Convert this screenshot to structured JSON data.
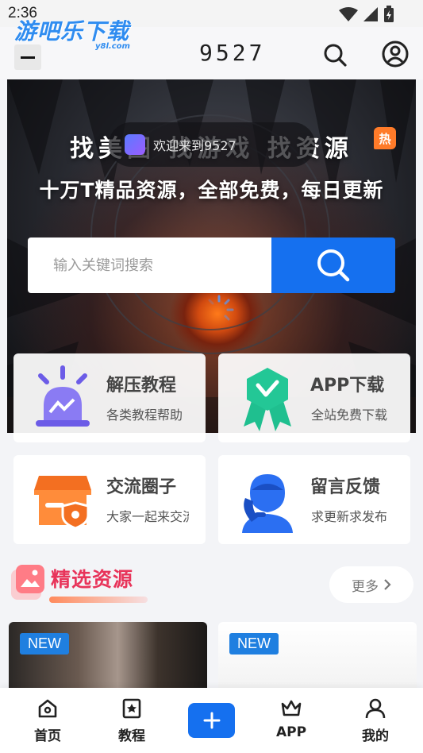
{
  "status_bar": {
    "time": "2:36"
  },
  "watermark": {
    "text": "游吧乐下载",
    "sub": "y8l.com"
  },
  "header": {
    "title": "9527"
  },
  "hero": {
    "title": "找美图 找游戏 找资源",
    "hot_badge": "热",
    "subtitle": "十万T精品资源，全部免费，每日更新",
    "toast": "欢迎来到9527",
    "search_placeholder": "输入关键词搜索"
  },
  "quick_links": [
    {
      "title": "解压教程",
      "desc": "各类教程帮助"
    },
    {
      "title": "APP下载",
      "desc": "全站免费下载"
    },
    {
      "title": "交流圈子",
      "desc": "大家一起来交流"
    },
    {
      "title": "留言反馈",
      "desc": "求更新求发布"
    }
  ],
  "featured": {
    "title": "精选资源",
    "more_label": "更多",
    "items": [
      {
        "badge": "NEW"
      },
      {
        "badge": "NEW"
      }
    ]
  },
  "bottom_nav": [
    {
      "label": "首页"
    },
    {
      "label": "教程"
    },
    {
      "label": "APP"
    },
    {
      "label": "我的"
    }
  ],
  "colors": {
    "accent": "#1570ef",
    "section_title": "#e8345a",
    "hot": "#ff7b29"
  }
}
